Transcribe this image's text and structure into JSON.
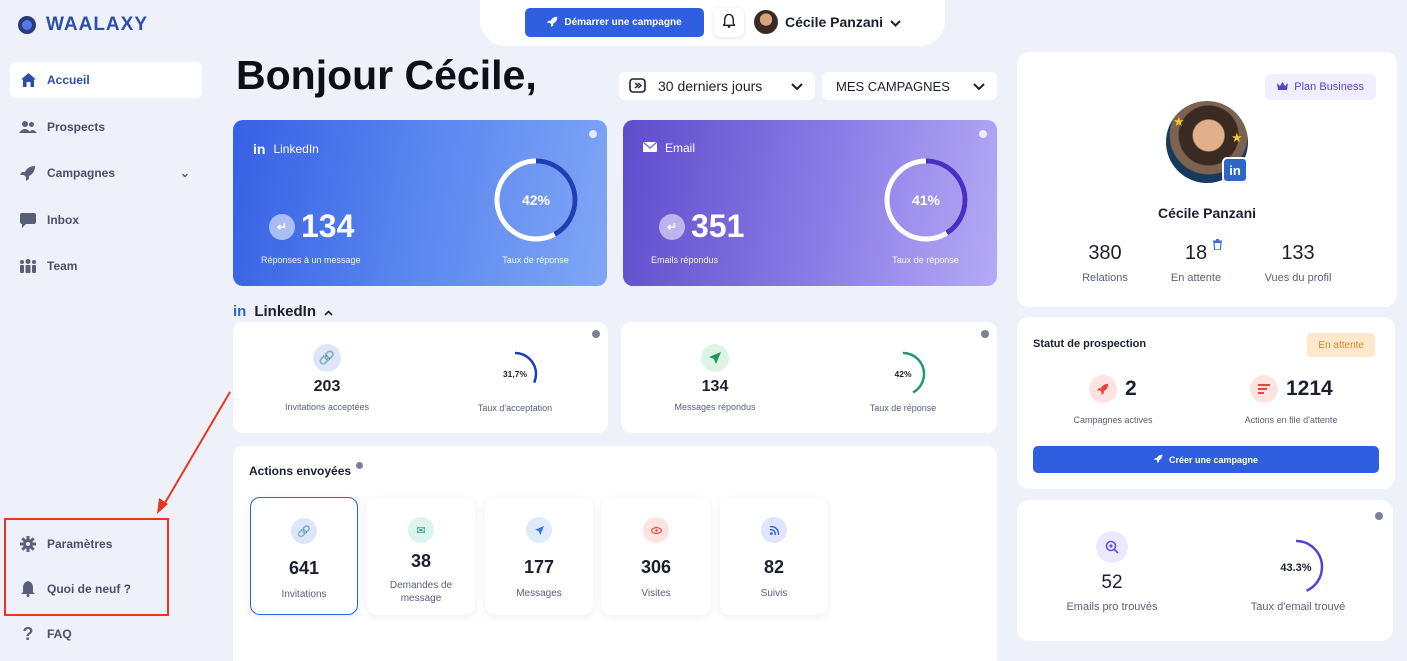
{
  "brand": {
    "name": "WAALAXY"
  },
  "sidebar": {
    "items": [
      {
        "label": "Accueil",
        "icon": "home-icon"
      },
      {
        "label": "Prospects",
        "icon": "users-icon"
      },
      {
        "label": "Campagnes",
        "icon": "rocket-icon"
      },
      {
        "label": "Inbox",
        "icon": "chat-icon"
      },
      {
        "label": "Team",
        "icon": "team-icon"
      }
    ],
    "bottom": [
      {
        "label": "Paramètres",
        "icon": "gear-icon"
      },
      {
        "label": "Quoi de neuf ?",
        "icon": "bell-icon"
      },
      {
        "label": "FAQ",
        "icon": "question-icon"
      }
    ]
  },
  "topbar": {
    "start_button": "Démarrer une campagne",
    "user_name": "Cécile Panzani"
  },
  "header": {
    "greeting": "Bonjour Cécile,",
    "period": "30 derniers jours",
    "campaign_filter": "MES CAMPAGNES"
  },
  "cards": {
    "linkedin": {
      "title": "LinkedIn",
      "value": "134",
      "value_label": "Réponses à un message",
      "rate": "42%",
      "rate_fraction": 0.42,
      "rate_label": "Taux de réponse"
    },
    "email": {
      "title": "Email",
      "value": "351",
      "value_label": "Emails répondus",
      "rate": "41%",
      "rate_fraction": 0.41,
      "rate_label": "Taux de réponse"
    }
  },
  "linkedin_section": {
    "title": "LinkedIn",
    "invitations": {
      "value": "203",
      "label": "Invitations acceptées"
    },
    "acceptance": {
      "rate": "31,7%",
      "rate_fraction": 0.317,
      "label": "Taux d'acceptation"
    },
    "messages": {
      "value": "134",
      "label": "Messages répondus"
    },
    "response": {
      "rate": "42%",
      "rate_fraction": 0.42,
      "label": "Taux de réponse"
    }
  },
  "actions": {
    "title": "Actions envoyées",
    "items": [
      {
        "value": "641",
        "label": "Invitations"
      },
      {
        "value": "38",
        "label": "Demandes de message"
      },
      {
        "value": "177",
        "label": "Messages"
      },
      {
        "value": "306",
        "label": "Visites"
      },
      {
        "value": "82",
        "label": "Suivis"
      }
    ]
  },
  "profile": {
    "plan": "Plan Business",
    "name": "Cécile Panzani",
    "stats": [
      {
        "value": "380",
        "label": "Relations"
      },
      {
        "value": "18",
        "label": "En attente"
      },
      {
        "value": "133",
        "label": "Vues du profil"
      }
    ]
  },
  "prospection": {
    "title": "Statut de prospection",
    "status": "En attente",
    "campaigns": {
      "value": "2",
      "label": "Campagnes actives"
    },
    "queue": {
      "value": "1214",
      "label": "Actions en file d'attente"
    },
    "create_button": "Créer une campagne"
  },
  "emails_found": {
    "value": "52",
    "label": "Emails pro trouvés",
    "rate": "43.3%",
    "rate_fraction": 0.433,
    "rate_label": "Taux d'email trouvé"
  },
  "colors": {
    "accent": "#2f5ee0",
    "highlight": "#e8361f"
  }
}
